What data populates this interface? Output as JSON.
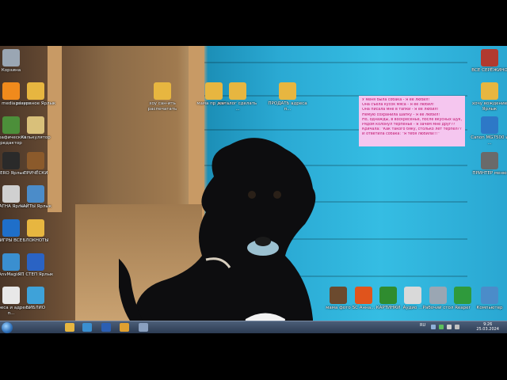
{
  "desktop_icons_left": [
    {
      "id": "recycle",
      "label": "Корзина",
      "icon": "recycle-bin-icon",
      "color": "#9aa6b3"
    },
    {
      "id": "vlc",
      "label": "VLC media player",
      "icon": "vlc-cone-icon",
      "color": "#f08a1c"
    },
    {
      "id": "rezervnoe",
      "label": "резервное Ярлык",
      "icon": "folder-icon",
      "color": "#e7b640"
    },
    {
      "id": "graphics",
      "label": "Графический редактор",
      "icon": "paint-icon",
      "color": "#4c8f3a"
    },
    {
      "id": "calculator",
      "label": "Калькулятор",
      "icon": "calculator-icon",
      "color": "#d9c07a"
    },
    {
      "id": "nero",
      "label": "NERO Ярлык",
      "icon": "nero-icon",
      "color": "#2a2a2a"
    },
    {
      "id": "pricheski",
      "label": "ПРИЧЁСКИ",
      "icon": "photo-folder-icon",
      "color": "#8b5a2b"
    },
    {
      "id": "magna",
      "label": "МАГНА Ярлык",
      "icon": "disc-icon",
      "color": "#d0d0d0"
    },
    {
      "id": "sajty",
      "label": "ЧАЙТЫ Ярлык",
      "icon": "computer-icon",
      "color": "#4b8cc9"
    },
    {
      "id": "igry",
      "label": "ИГРЫ ВСЕ",
      "icon": "info-icon",
      "color": "#1f6fc9"
    },
    {
      "id": "bloknoty",
      "label": "БЛОКНОТЫ",
      "icon": "folder-icon",
      "color": "#e7b640"
    },
    {
      "id": "magic",
      "label": "AnvMagic...",
      "icon": "network-icon",
      "color": "#3a8fd0"
    },
    {
      "id": "help",
      "label": "ЯП СТЕП Ярлык",
      "icon": "help-icon",
      "color": "#2a63c4"
    },
    {
      "id": "adres",
      "label": "Адреса и адреса п...",
      "icon": "document-icon",
      "color": "#e8e8e8"
    },
    {
      "id": "biblio",
      "label": "БИБЛИО",
      "icon": "globe-icon",
      "color": "#3ea2d9"
    }
  ],
  "desktop_icons_top": [
    {
      "id": "top1",
      "label": "хоу сан-ить распечатать",
      "icon": "folder-icon",
      "color": "#e7b640"
    },
    {
      "id": "top2",
      "label": "мама пр для ...",
      "icon": "folder-icon",
      "color": "#e7b640"
    },
    {
      "id": "top3",
      "label": "каталог сделать ...",
      "icon": "folder-icon",
      "color": "#e7b640"
    },
    {
      "id": "top4",
      "label": "ПРОДАТЬ адреса п...",
      "icon": "folder-icon",
      "color": "#e7b640"
    }
  ],
  "desktop_icons_right": [
    {
      "id": "vse",
      "label": "ВСЕ СЕРЁЖИНО",
      "icon": "person-photo-icon",
      "color": "#b13a2f"
    },
    {
      "id": "hochu",
      "label": "хочу вождение Ярлык",
      "icon": "folder-icon",
      "color": "#e7b640"
    },
    {
      "id": "canon",
      "label": "Canon MG7500 и ...",
      "icon": "printer-icon",
      "color": "#2d78c7"
    },
    {
      "id": "printer",
      "label": "ПРИНТЕР меню",
      "icon": "printer-icon",
      "color": "#6a6a6a"
    }
  ],
  "desktop_icons_bottom": [
    {
      "id": "b1",
      "label": "мама фото",
      "icon": "photo-icon",
      "color": "#6b4a2e"
    },
    {
      "id": "b2",
      "label": "SC Анна...",
      "icon": "power-icon",
      "color": "#e0541c"
    },
    {
      "id": "b3",
      "label": "КАРТИНКИ",
      "icon": "tree-icon",
      "color": "#2f8c2f"
    },
    {
      "id": "b4",
      "label": "Аудио ...",
      "icon": "tools-icon",
      "color": "#d9d9d9"
    },
    {
      "id": "b5",
      "label": "Рабочий стол",
      "icon": "trash-icon",
      "color": "#9aa6b3"
    },
    {
      "id": "b6",
      "label": "Reaper",
      "icon": "k-icon",
      "color": "#2f9a3c"
    },
    {
      "id": "b7",
      "label": "Компьютер",
      "icon": "computer-icon",
      "color": "#4b8cc9"
    }
  ],
  "sticky_note": {
    "lines": [
      "У меня была собака - Я её любил!",
      "Она съела кусок мяса - Я её любил!",
      "Она писала мне в тапки - Я её любил!",
      "Немую сохранила шапку - Я её любил!",
      "Но, однажды, в воскресенье, после вкусных щук,",
      "Рядом колонул терпенье - Я зачем мне друг??",
      "Кричала: \"Как такого бяку, столько лет терпел??\"",
      "И ответила собака: \"Я тебя любила!!!\""
    ]
  },
  "taskbar": {
    "lang": "RU",
    "time": "9:26",
    "date": "25.03.2024",
    "items": [
      {
        "icon": "explorer-icon",
        "color": "#e7b640"
      },
      {
        "icon": "ie-icon",
        "color": "#3a8fd0"
      },
      {
        "icon": "word-icon",
        "color": "#2b5fb3"
      },
      {
        "icon": "media-player-icon",
        "color": "#e0a030"
      },
      {
        "icon": "app-icon",
        "color": "#8aa0c0"
      }
    ]
  }
}
